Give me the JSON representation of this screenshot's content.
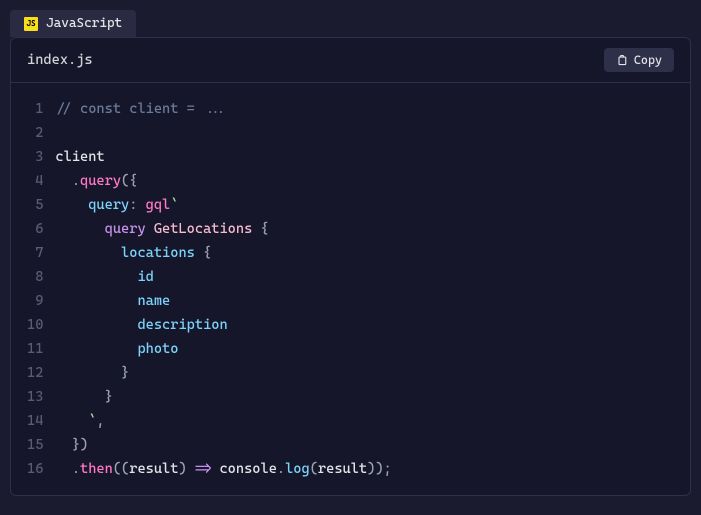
{
  "tab": {
    "label": "JavaScript",
    "icon_text": "JS"
  },
  "header": {
    "filename": "index.js",
    "copy_label": "Copy"
  },
  "code": {
    "lines": [
      {
        "n": "1"
      },
      {
        "n": "2"
      },
      {
        "n": "3"
      },
      {
        "n": "4"
      },
      {
        "n": "5"
      },
      {
        "n": "6"
      },
      {
        "n": "7"
      },
      {
        "n": "8"
      },
      {
        "n": "9"
      },
      {
        "n": "10"
      },
      {
        "n": "11"
      },
      {
        "n": "12"
      },
      {
        "n": "13"
      },
      {
        "n": "14"
      },
      {
        "n": "15"
      },
      {
        "n": "16"
      }
    ],
    "tokens": {
      "l1_comment": "// const client = ...",
      "l3_client": "client",
      "l4_indent": "  ",
      "l4_dot": ".",
      "l4_query": "query",
      "l4_paren": "({",
      "l5_indent": "    ",
      "l5_queryprop": "query",
      "l5_colon": ": ",
      "l5_gql": "gql",
      "l5_tick": "`",
      "l6_indent": "      ",
      "l6_keyword": "query",
      "l6_space": " ",
      "l6_name": "GetLocations",
      "l6_brace": " {",
      "l7_indent": "        ",
      "l7_field": "locations",
      "l7_brace": " {",
      "l8_indent": "          ",
      "l8_field": "id",
      "l9_indent": "          ",
      "l9_field": "name",
      "l10_indent": "          ",
      "l10_field": "description",
      "l11_indent": "          ",
      "l11_field": "photo",
      "l12_indent": "        ",
      "l12_brace": "}",
      "l13_indent": "      ",
      "l13_brace": "}",
      "l14_indent": "    ",
      "l14_tick": "`",
      "l14_comma": ",",
      "l15_indent": "  ",
      "l15_close": "})",
      "l16_indent": "  ",
      "l16_dot": ".",
      "l16_then": "then",
      "l16_p1": "((",
      "l16_result1": "result",
      "l16_p2": ") ",
      "l16_arrow": "=>",
      "l16_sp": " ",
      "l16_console": "console",
      "l16_dot2": ".",
      "l16_log": "log",
      "l16_p3": "(",
      "l16_result2": "result",
      "l16_p4": "));"
    }
  }
}
